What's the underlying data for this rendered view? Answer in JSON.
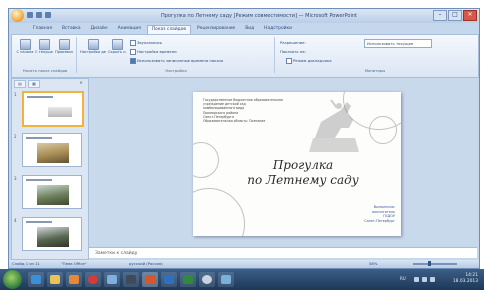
{
  "window": {
    "title": "Прогулка по Летнему саду [Режим совместимости] — Microsoft PowerPoint",
    "controls": {
      "minimize": "–",
      "maximize": "□",
      "close": "✕"
    }
  },
  "ribbon": {
    "tabs": [
      "Главная",
      "Вставка",
      "Дизайн",
      "Анимация",
      "Показ слайдов",
      "Рецензирование",
      "Вид",
      "Надстройки"
    ],
    "active_tab": "Показ слайдов",
    "groups": {
      "start": {
        "label": "Начать показ слайдов",
        "buttons": [
          "С начала",
          "С текущего слайда",
          "Произвольный показ"
        ]
      },
      "setup": {
        "label": "Настройка",
        "buttons": [
          "Настройка демонстрации",
          "Скрыть слайд"
        ],
        "options": [
          {
            "label": "Звукозапись",
            "checked": false
          },
          {
            "label": "Настройка времени",
            "checked": false
          },
          {
            "label": "Использовать записанные времена показа",
            "checked": true
          }
        ]
      },
      "monitors": {
        "label": "Мониторы",
        "resolution_label": "Разрешение:",
        "resolution_value": "Использовать текущее",
        "show_on_label": "Показать на:",
        "presenter_view": "Режим докладчика"
      }
    }
  },
  "slides_pane": {
    "tabs": [
      "▤",
      "▦"
    ],
    "close": "✕",
    "thumbnails": [
      {
        "number": "1",
        "selected": true
      },
      {
        "number": "2",
        "selected": false
      },
      {
        "number": "3",
        "selected": false
      },
      {
        "number": "4",
        "selected": false
      }
    ]
  },
  "slide": {
    "info_lines": [
      "Государственное бюджетное образовательное",
      "учреждение детский сад",
      "комбинированного вида",
      "Приморского района",
      "Санкт-Петербурга",
      "Образовательная область: Познание"
    ],
    "title_line1": "Прогулка",
    "title_line2": "по Летнему саду",
    "author_lines": [
      "Выполнила:",
      "воспитатель",
      "ГБДОУ",
      "Санкт-Петербург"
    ]
  },
  "notes": {
    "placeholder": "Заметки к слайду"
  },
  "statusbar": {
    "slide_counter": "Слайд 1 из 11",
    "theme": "\"Тема Office\"",
    "language": "русский (Россия)",
    "zoom": "58%"
  },
  "taskbar": {
    "language": "RU",
    "clock_time": "14:21",
    "clock_date": "18.03.2013",
    "apps": [
      {
        "name": "ie-icon",
        "color": "#3a8fd8"
      },
      {
        "name": "explorer-icon",
        "color": "#e8c35a"
      },
      {
        "name": "media-player-icon",
        "color": "#e8873a"
      },
      {
        "name": "opera-icon",
        "color": "#d83a3a"
      },
      {
        "name": "yandex-icon",
        "color": "#7fb0e0"
      },
      {
        "name": "film-icon",
        "color": "#404a58"
      },
      {
        "name": "powerpoint-icon",
        "color": "#d9552c"
      },
      {
        "name": "word-icon",
        "color": "#2f6fc0"
      },
      {
        "name": "excel-icon",
        "color": "#2f8a3e"
      },
      {
        "name": "cd-icon",
        "color": "#c9d4e0"
      },
      {
        "name": "paint-icon",
        "color": "#7bb0d8"
      }
    ]
  }
}
